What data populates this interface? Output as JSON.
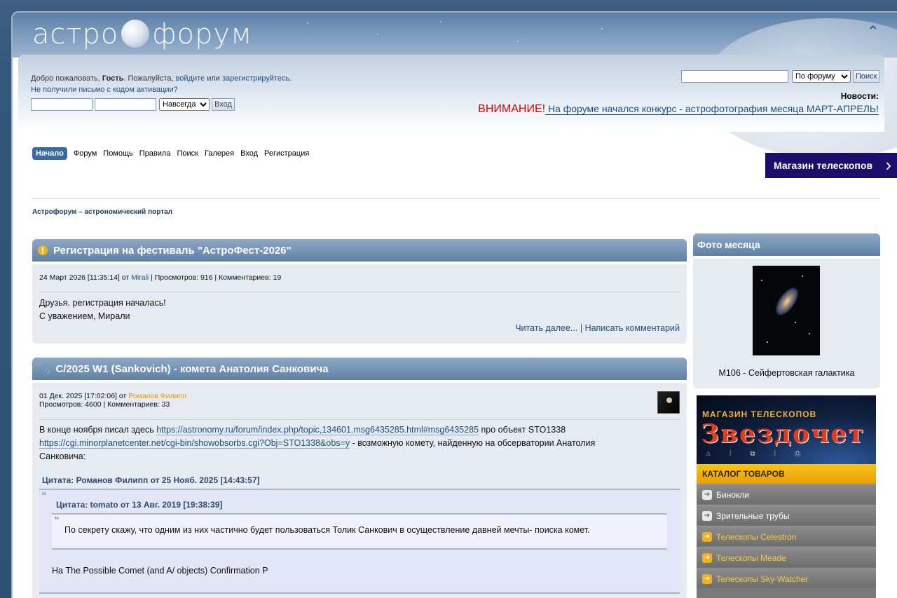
{
  "brand": {
    "logo_left": "астро",
    "logo_right": "форум"
  },
  "header": {
    "welcome_prefix": "Добро пожаловать, ",
    "guest": "Гость",
    "welcome_suffix": ". Пожалуйста, ",
    "login_link": "войдите",
    "or": " или ",
    "register_link": "зарегистрируйтесь",
    "activation": "Не получили письмо с кодом активации?",
    "duration_option": "Навсегда",
    "login_button": "Вход",
    "search_scope": "По форуму",
    "search_button": "Поиск",
    "news_label": "Новости:",
    "news_warning": "ВНИМАНИЕ!",
    "news_text": " На форуме  начался конкурс - астрофотография месяца МАРТ-АПРЕЛЬ!"
  },
  "menu": [
    "Начало",
    "Форум",
    "Помощь",
    "Правила",
    "Поиск",
    "Галерея",
    "Вход",
    "Регистрация"
  ],
  "shop_button": "Магазин телескопов",
  "breadcrumb": "Астрофорум – астрономический портал",
  "topics": [
    {
      "title": "Регистрация на фестиваль \"АстроФест-2026\"",
      "meta_date": "24 Март 2026 [11:35:14] от ",
      "meta_author": "Mirali",
      "meta_stats": " | Просмотров: 916 | Комментариев: 19",
      "body_line1": "Друзья. регистрация началась!",
      "body_line2": "С уважением, Мирали",
      "read_more": "Читать далее...",
      "sep": " | ",
      "comment": "Написать комментарий"
    },
    {
      "title": "C/2025 W1 (Sankovich) - комета Анатолия Санковича",
      "meta_date": "01 Дек. 2025 [17:02:06] от ",
      "meta_author": "Романов Филипп",
      "meta_stats": "Просмотров: 4600 | Комментариев: 33",
      "body_pre": "В конце ноября писал здесь ",
      "link1": "https://astronomy.ru/forum/index.php/topic,134601.msg6435285.html#msg6435285",
      "body_mid": " про объект STO1338",
      "link2": "https://cgi.minorplanetcenter.net/cgi-bin/showobsorbs.cgi?Obj=STO1338&obs=y",
      "body_post": " - возможную комету, найденную на обсерватории Анатолия",
      "body_post2": "Санковича:",
      "quote1_header": "Цитата: Романов Филипп от 25 Нояб. 2025 [14:43:57]",
      "quote2_header": "Цитата: tomato от 13 Авг. 2019 [19:38:39]",
      "quote2_text": "По секрету скажу, что одним из них частично будет пользоваться Толик Санкович в осуществление давней мечты- поиска комет.",
      "quote1_text": "На The Possible Comet (and A/ objects) Confirmation P"
    }
  ],
  "sidebar": {
    "title": "Фото месяца",
    "caption": "M106 - Сейфертовская галактика"
  },
  "shop_ad": {
    "small": "МАГАЗИН ТЕЛЕСКОПОВ",
    "name": "Звездочет",
    "catalog": "КАТАЛОГ ТОВАРОВ",
    "items": [
      "Бинокли",
      "Зрительные трубы",
      "Телескопы Celestron",
      "Телескопы Meade",
      "Телескопы Sky-Watcher"
    ]
  },
  "colors": {
    "accent": "#5f80a5",
    "warning": "#e00000",
    "shop_bg": "#1b0f6b",
    "author_orange": "#e7980a"
  }
}
